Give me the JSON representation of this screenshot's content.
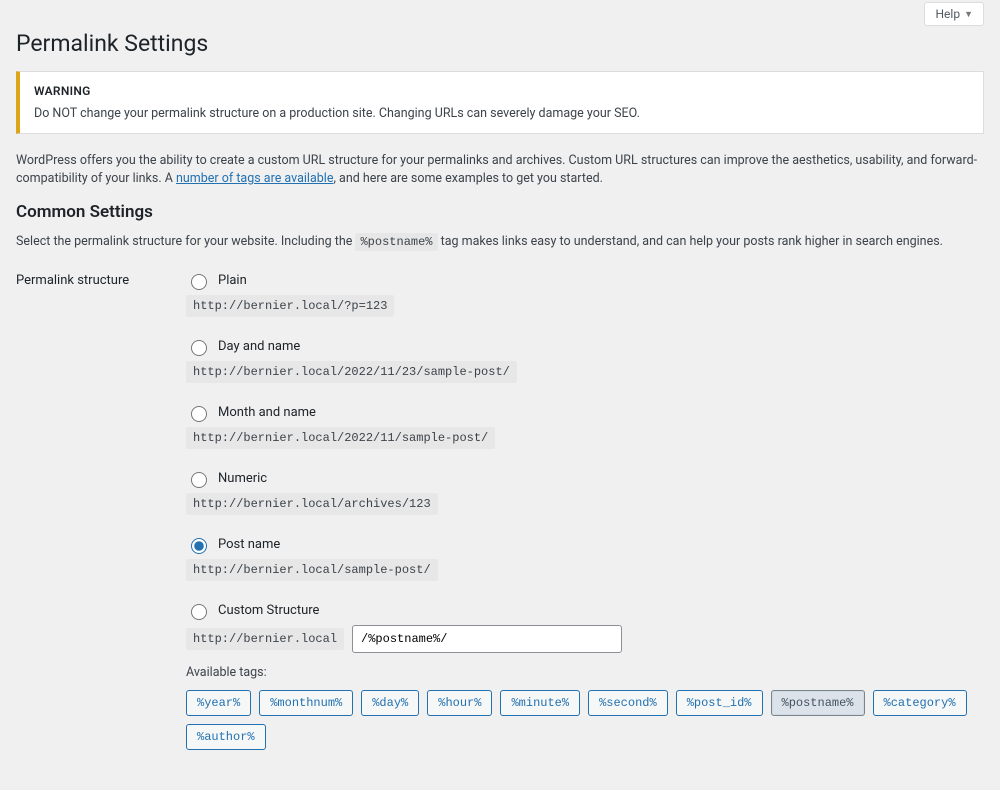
{
  "help_label": "Help",
  "page_title": "Permalink Settings",
  "warning": {
    "title": "WARNING",
    "text": "Do NOT change your permalink structure on a production site. Changing URLs can severely damage your SEO."
  },
  "intro": {
    "part1": "WordPress offers you the ability to create a custom URL structure for your permalinks and archives. Custom URL structures can improve the aesthetics, usability, and forward-compatibility of your links. A ",
    "link_text": "number of tags are available",
    "part2": ", and here are some examples to get you started."
  },
  "common_settings_title": "Common Settings",
  "structure_desc": {
    "pre": "Select the permalink structure for your website. Including the ",
    "code": "%postname%",
    "post": " tag makes links easy to understand, and can help your posts rank higher in search engines."
  },
  "field_label": "Permalink structure",
  "options": {
    "plain": {
      "label": "Plain",
      "example": "http://bernier.local/?p=123"
    },
    "dayname": {
      "label": "Day and name",
      "example": "http://bernier.local/2022/11/23/sample-post/"
    },
    "monthname": {
      "label": "Month and name",
      "example": "http://bernier.local/2022/11/sample-post/"
    },
    "numeric": {
      "label": "Numeric",
      "example": "http://bernier.local/archives/123"
    },
    "postname": {
      "label": "Post name",
      "example": "http://bernier.local/sample-post/"
    },
    "custom": {
      "label": "Custom Structure",
      "base": "http://bernier.local",
      "value": "/%postname%/"
    }
  },
  "available_label": "Available tags:",
  "tags": [
    "%year%",
    "%monthnum%",
    "%day%",
    "%hour%",
    "%minute%",
    "%second%",
    "%post_id%",
    "%postname%",
    "%category%",
    "%author%"
  ],
  "selected_tag": "%postname%"
}
